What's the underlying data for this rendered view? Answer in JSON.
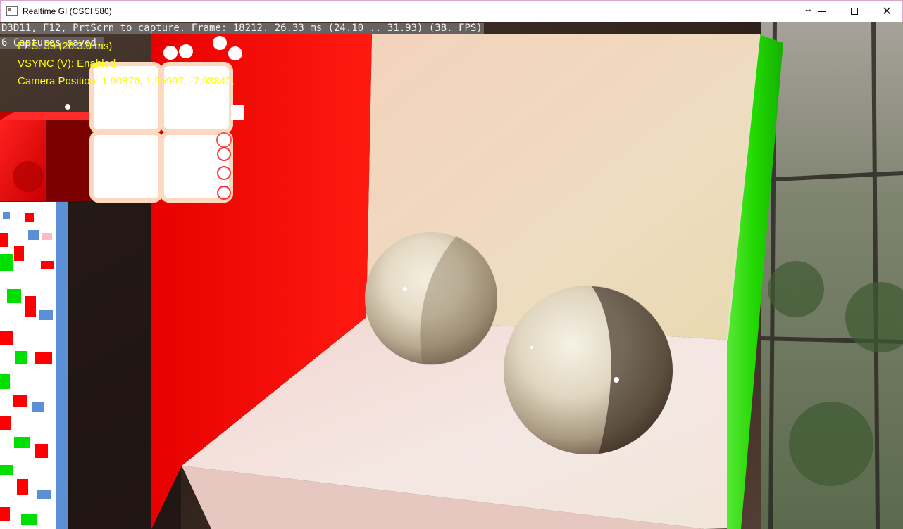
{
  "window": {
    "title": "Realtime GI (CSCI 580)",
    "resize_icon": "resize-horizontal-icon",
    "minimize_icon": "minimize-icon",
    "maximize_icon": "maximize-icon",
    "close_icon": "close-icon"
  },
  "overlay": {
    "stats": "D3D11, F12, PrtScrn to capture. Frame: 18212. 26.33 ms (24.10 .. 31.93) (38. FPS)",
    "captures": "6 Captures saved.",
    "fps": "FPS: 39 (26.3.0 ms)",
    "vsync": "VSYNC (V): Enabled",
    "camera": "Camera Position: 1.90876, 1.95997, -7.93842,"
  },
  "colors": {
    "hud_text": "#ffff00",
    "left_wall": "#ff0000",
    "right_wall": "#22e000",
    "back_wall": "#f0dcc0",
    "floor": "#f5e4e0"
  }
}
